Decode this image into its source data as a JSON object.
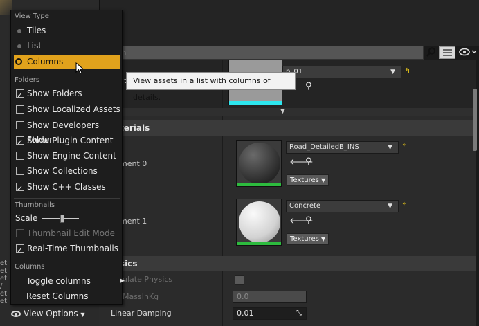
{
  "search": {
    "placeholder_fragment": "ch"
  },
  "tooltip": {
    "text": "View assets in a list with columns of details."
  },
  "details": {
    "top_asset": {
      "name_fragment": "p_01",
      "label_fragment": "t"
    },
    "materials_header": "terials",
    "element0": {
      "label": "ment 0",
      "material": "Road_DetailedB_INS",
      "button": "Textures"
    },
    "element1": {
      "label": "ment 1",
      "material": "Concrete",
      "button": "Textures"
    },
    "physics_header": "sics",
    "simulate_label": "ulate Physics",
    "mass_label": "MassInKg",
    "mass_value": "0.0",
    "linear_damping_label": "Linear Damping",
    "linear_damping_value": "0.01"
  },
  "menu": {
    "view_type_header": "View Type",
    "view_types": [
      {
        "label": "Tiles",
        "selected": false
      },
      {
        "label": "List",
        "selected": false
      },
      {
        "label": "Columns",
        "selected": true
      }
    ],
    "folders_header": "Folders",
    "folder_options": [
      {
        "label": "Show Folders",
        "checked": true
      },
      {
        "label": "Show Localized Assets",
        "checked": false
      },
      {
        "label": "Show Developers Folder",
        "checked": false
      },
      {
        "label": "Show Plugin Content",
        "checked": true
      },
      {
        "label": "Show Engine Content",
        "checked": false
      },
      {
        "label": "Show Collections",
        "checked": false
      },
      {
        "label": "Show C++ Classes",
        "checked": true
      }
    ],
    "thumbnails_header": "Thumbnails",
    "scale_label": "Scale",
    "scale_value": 0.55,
    "thumbnail_options": [
      {
        "label": "Thumbnail Edit Mode",
        "checked": false,
        "disabled": true
      },
      {
        "label": "Real-Time Thumbnails",
        "checked": true,
        "disabled": false
      }
    ],
    "columns_header": "Columns",
    "columns_items": [
      {
        "label": "Toggle columns"
      },
      {
        "label": "Reset Columns"
      }
    ]
  },
  "bottom": {
    "view_options_label": "View Options"
  },
  "left_stub": [
    "et",
    "et",
    "et",
    "/",
    "et",
    "et"
  ],
  "colors": {
    "accent": "#e1a21c",
    "green": "#2dbb3e",
    "reset": "#e4c31a"
  }
}
